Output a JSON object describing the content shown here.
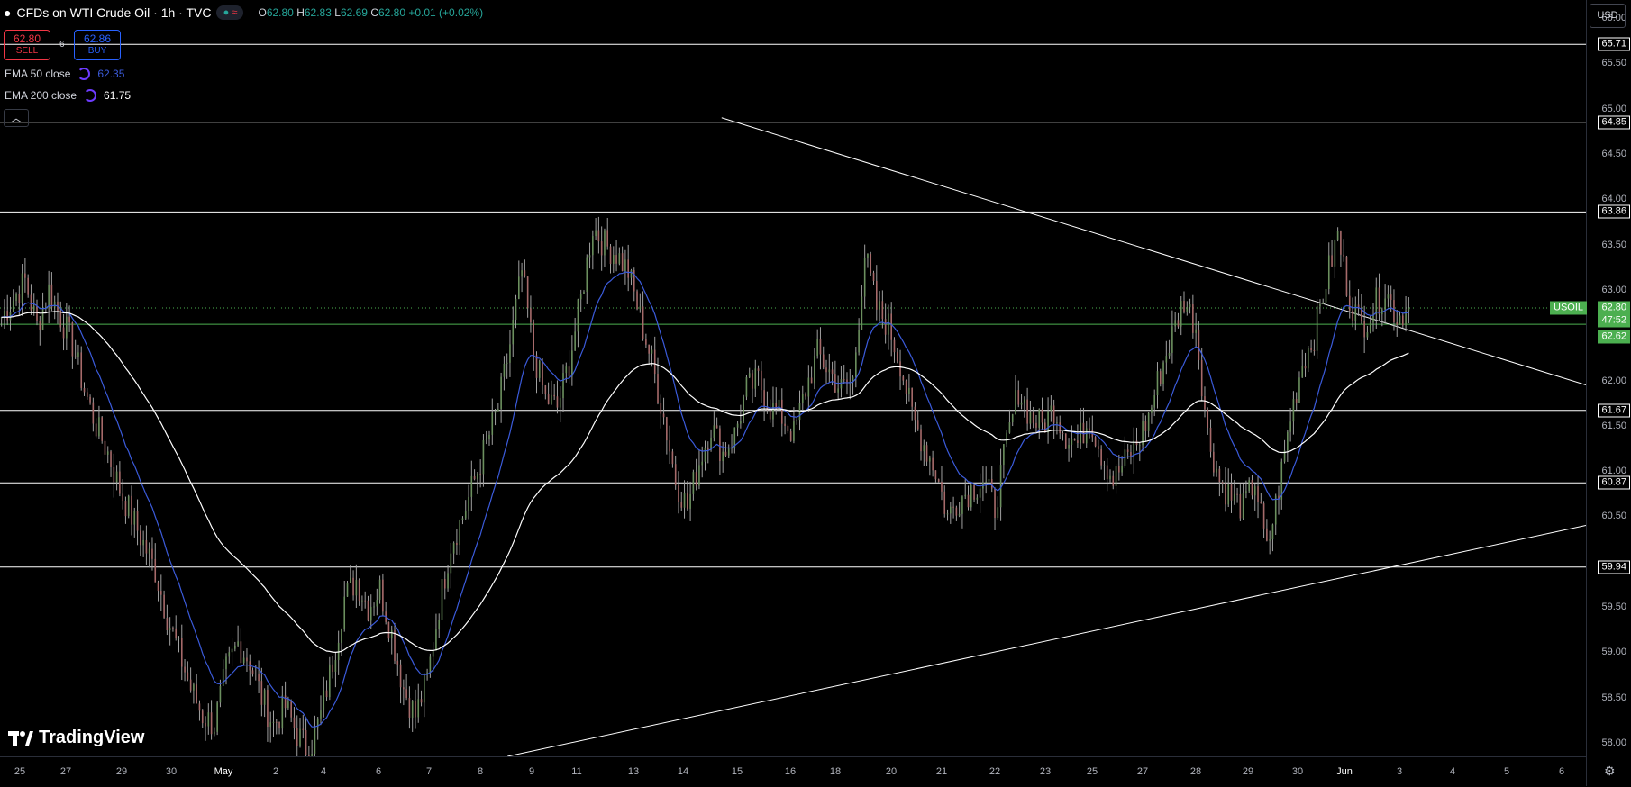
{
  "header": {
    "title": "CFDs on WTI Crude Oil · 1h · TVC",
    "ohlc": {
      "o_label": "O",
      "o": "62.80",
      "h_label": "H",
      "h": "62.83",
      "l_label": "L",
      "l": "62.69",
      "c_label": "C",
      "c": "62.80",
      "change": "+0.01 (+0.02%)"
    }
  },
  "trade": {
    "sell_price": "62.80",
    "sell_label": "SELL",
    "buy_price": "62.86",
    "buy_label": "BUY",
    "spread": "6"
  },
  "indicators": [
    {
      "label": "EMA 50 close",
      "value": "62.35",
      "color": "#3b5bdb"
    },
    {
      "label": "EMA 200 close",
      "value": "61.75",
      "color": "#ffffff"
    }
  ],
  "collapse_icon": "chevron-up-icon",
  "currency": "USD",
  "logo_text": "TradingView",
  "price_axis": {
    "ticks": [
      "66.00",
      "65.50",
      "65.00",
      "64.50",
      "64.00",
      "63.50",
      "63.00",
      "62.00",
      "61.50",
      "61.00",
      "60.50",
      "59.50",
      "59.00",
      "58.50",
      "58.00"
    ],
    "badges": {
      "l1": "65.71",
      "l2": "64.85",
      "l3": "63.86",
      "l4": "61.67",
      "l5": "60.87",
      "l6": "59.94",
      "symbol": "USOIL",
      "last": "62.80",
      "countdown": "47:52",
      "green": "62.62"
    }
  },
  "time_axis": [
    "25",
    "27",
    "29",
    "30",
    "May",
    "2",
    "4",
    "6",
    "7",
    "8",
    "9",
    "11",
    "13",
    "14",
    "15",
    "16",
    "18",
    "20",
    "21",
    "22",
    "23",
    "25",
    "27",
    "28",
    "29",
    "30",
    "Jun",
    "3",
    "4",
    "5",
    "6"
  ],
  "chart_data": {
    "type": "candlestick",
    "symbol": "USOIL",
    "ylim": [
      57.85,
      66.2
    ],
    "horizontal_levels": [
      65.71,
      64.85,
      63.86,
      61.67,
      60.87,
      59.94
    ],
    "last_price": 62.8,
    "green_level": 62.62,
    "trendlines": [
      {
        "from": {
          "t": 0.455,
          "p": 64.9
        },
        "to": {
          "t": 1.0,
          "p": 61.95
        }
      },
      {
        "from": {
          "t": 0.32,
          "p": 57.85
        },
        "to": {
          "t": 1.0,
          "p": 60.4
        }
      }
    ],
    "colors": {
      "ema50": "#3b5bdb",
      "ema200": "#ffffff",
      "level": "#ffffff",
      "green": "#4caf50"
    },
    "closes_anchor": [
      62.7,
      62.9,
      63.1,
      62.6,
      63.0,
      62.7,
      62.4,
      61.9,
      61.5,
      61.2,
      60.8,
      60.5,
      60.2,
      59.9,
      59.4,
      59.0,
      58.6,
      58.3,
      58.2,
      58.8,
      59.1,
      58.9,
      58.5,
      58.2,
      58.4,
      58.1,
      57.9,
      58.3,
      58.9,
      59.6,
      59.8,
      59.5,
      59.7,
      59.2,
      58.6,
      58.3,
      58.7,
      59.5,
      60.2,
      60.5,
      60.9,
      61.3,
      61.7,
      62.4,
      63.2,
      62.3,
      61.8,
      61.7,
      62.2,
      62.9,
      63.7,
      63.5,
      63.4,
      63.2,
      62.7,
      62.2,
      61.6,
      60.9,
      60.6,
      61.1,
      61.5,
      61.2,
      61.4,
      61.9,
      62.0,
      61.7,
      61.6,
      61.4,
      61.9,
      62.3,
      62.1,
      61.9,
      62.0,
      63.4,
      62.8,
      62.6,
      62.2,
      61.6,
      61.3,
      61.0,
      60.5,
      60.7,
      60.8,
      60.9,
      60.6,
      61.3,
      61.9,
      61.6,
      61.5,
      61.7,
      61.4,
      61.3,
      61.6,
      61.2,
      60.9,
      61.1,
      61.3,
      61.6,
      62.1,
      62.5,
      62.9,
      62.6,
      61.4,
      60.9,
      60.7,
      60.6,
      60.9,
      60.1,
      60.8,
      61.6,
      62.2,
      62.5,
      63.1,
      63.6,
      62.9,
      62.6,
      62.8,
      63.0,
      62.7,
      62.8
    ]
  }
}
